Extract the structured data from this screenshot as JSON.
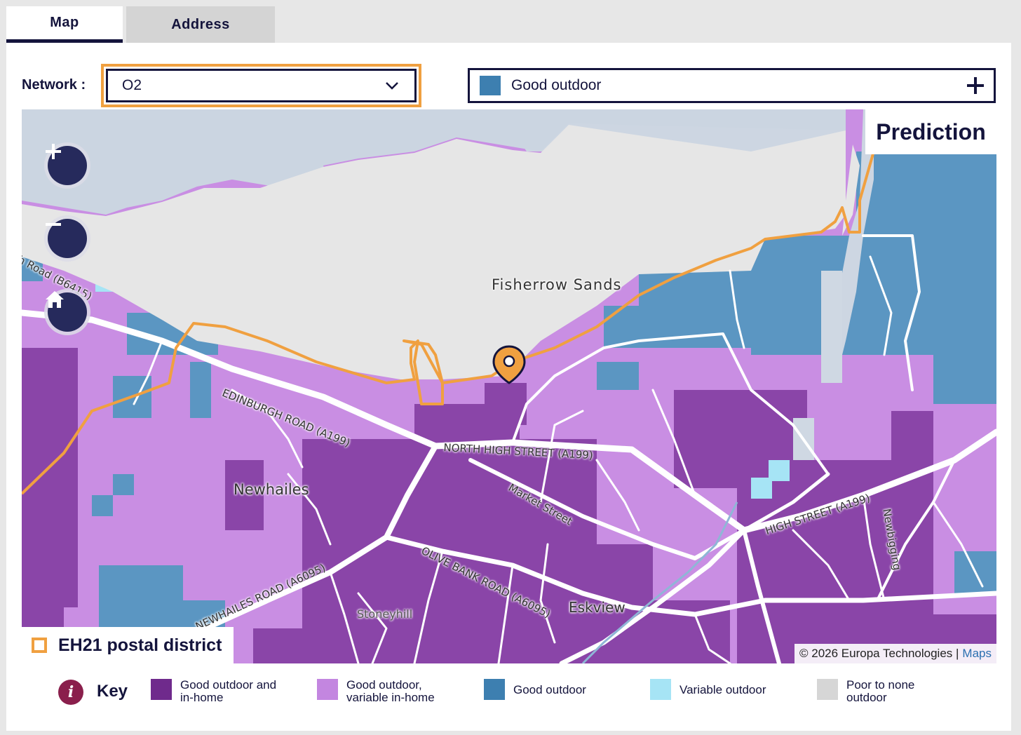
{
  "tabs": [
    {
      "label": "Map",
      "active": true
    },
    {
      "label": "Address",
      "active": false
    }
  ],
  "network": {
    "label": "Network :",
    "selected": "O2"
  },
  "layer": {
    "label": "Good outdoor",
    "swatch_color": "#3d7fb0"
  },
  "map": {
    "overlay_title": "Prediction",
    "postal_district": "EH21 postal district",
    "attribution": "© 2026 Europa Technologies |",
    "attribution_link": "Maps",
    "place_labels": {
      "fisherrow": "Fisherrow Sands",
      "newhailes": "Newhailes",
      "eskview": "Eskview",
      "stoneyhill": "Stoneyhill",
      "edinburgh_road": "EDINBURGH ROAD (A199)",
      "north_high_street": "NORTH HIGH STREET (A199)",
      "market_street": "Market Street",
      "olive_bank": "OLIVE BANK ROAD (A6095)",
      "newhailes_road": "NEWHAILES ROAD (A6095)",
      "high_street": "HIGH STREET (A199)",
      "newbigging": "Newbigging",
      "road_west": "h Road (B6415)"
    },
    "icons": [
      "zoom-in-icon",
      "zoom-out-icon",
      "home-icon",
      "location-pin-icon"
    ]
  },
  "legend": {
    "title": "Key",
    "items": [
      {
        "label": "Good outdoor and in-home",
        "color": "#6f2a8c"
      },
      {
        "label": "Good outdoor, variable in-home",
        "color": "#c386e0"
      },
      {
        "label": "Good outdoor",
        "color": "#3d7fb0"
      },
      {
        "label": "Variable outdoor",
        "color": "#a6e4f5"
      },
      {
        "label": "Poor to none outdoor",
        "color": "#d6d6d6"
      }
    ]
  },
  "colors": {
    "accent_orange": "#f0a040",
    "navy": "#14143c",
    "sea": "#cfd8e3",
    "sand": "#e6e6e6"
  }
}
